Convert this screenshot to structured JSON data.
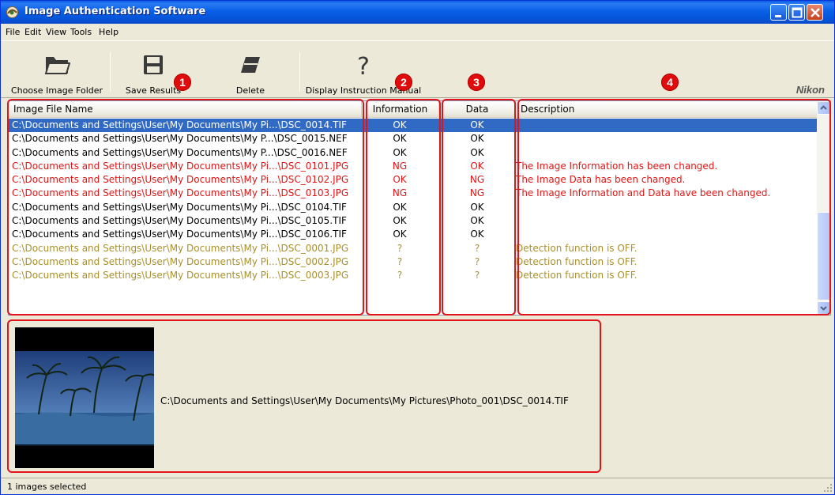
{
  "window": {
    "title": "Image Authentication Software"
  },
  "menu": [
    "File",
    "Edit",
    "View",
    "Tools",
    "Help"
  ],
  "toolbar": {
    "buttons": [
      {
        "label": "Choose Image Folder",
        "icon": "folder-icon"
      },
      {
        "label": "Save Results",
        "icon": "save-icon"
      },
      {
        "label": "Delete",
        "icon": "eraser-icon"
      },
      {
        "label": "Display Instruction Manual",
        "icon": "help-icon"
      }
    ],
    "brand": "Nikon"
  },
  "badges": [
    "1",
    "2",
    "3",
    "4"
  ],
  "list": {
    "columns": [
      "Image File Name",
      "Information",
      "Data",
      "Description"
    ],
    "rows": [
      {
        "file": "C:\\Documents and Settings\\User\\My Documents\\My Pi...\\DSC_0014.TIF",
        "info": "OK",
        "data": "OK",
        "desc": "",
        "state": "selected"
      },
      {
        "file": "C:\\Documents and Settings\\User\\My Documents\\My P...\\DSC_0015.NEF",
        "info": "OK",
        "data": "OK",
        "desc": "",
        "state": "normal"
      },
      {
        "file": "C:\\Documents and Settings\\User\\My Documents\\My P...\\DSC_0016.NEF",
        "info": "OK",
        "data": "OK",
        "desc": "",
        "state": "normal"
      },
      {
        "file": "C:\\Documents and Settings\\User\\My Documents\\My Pi...\\DSC_0101.JPG",
        "info": "NG",
        "data": "OK",
        "desc": "The Image Information has been changed.",
        "state": "red"
      },
      {
        "file": "C:\\Documents and Settings\\User\\My Documents\\My Pi...\\DSC_0102.JPG",
        "info": "OK",
        "data": "NG",
        "desc": "The Image Data has been changed.",
        "state": "red"
      },
      {
        "file": "C:\\Documents and Settings\\User\\My Documents\\My Pi...\\DSC_0103.JPG",
        "info": "NG",
        "data": "NG",
        "desc": "The Image Information and Data have been changed.",
        "state": "red"
      },
      {
        "file": "C:\\Documents and Settings\\User\\My Documents\\My Pi...\\DSC_0104.TIF",
        "info": "OK",
        "data": "OK",
        "desc": "",
        "state": "normal"
      },
      {
        "file": "C:\\Documents and Settings\\User\\My Documents\\My Pi...\\DSC_0105.TIF",
        "info": "OK",
        "data": "OK",
        "desc": "",
        "state": "normal"
      },
      {
        "file": "C:\\Documents and Settings\\User\\My Documents\\My Pi...\\DSC_0106.TIF",
        "info": "OK",
        "data": "OK",
        "desc": "",
        "state": "normal"
      },
      {
        "file": "C:\\Documents and Settings\\User\\My Documents\\My Pi...\\DSC_0001.JPG",
        "info": "?",
        "data": "?",
        "desc": "Detection function is OFF.",
        "state": "olive"
      },
      {
        "file": "C:\\Documents and Settings\\User\\My Documents\\My Pi...\\DSC_0002.JPG",
        "info": "?",
        "data": "?",
        "desc": "Detection function is OFF.",
        "state": "olive"
      },
      {
        "file": "C:\\Documents and Settings\\User\\My Documents\\My Pi...\\DSC_0003.JPG",
        "info": "?",
        "data": "?",
        "desc": "Detection function is OFF.",
        "state": "olive"
      }
    ]
  },
  "preview": {
    "path": "C:\\Documents and Settings\\User\\My Documents\\My Pictures\\Photo_001\\DSC_0014.TIF",
    "thumbnail": "palm-trees-photo"
  },
  "status": {
    "text": "1 images selected"
  },
  "colors": {
    "selected": "#316AC5",
    "error": "#E01515",
    "off": "#A8902A",
    "annotation": "#E0141A"
  }
}
